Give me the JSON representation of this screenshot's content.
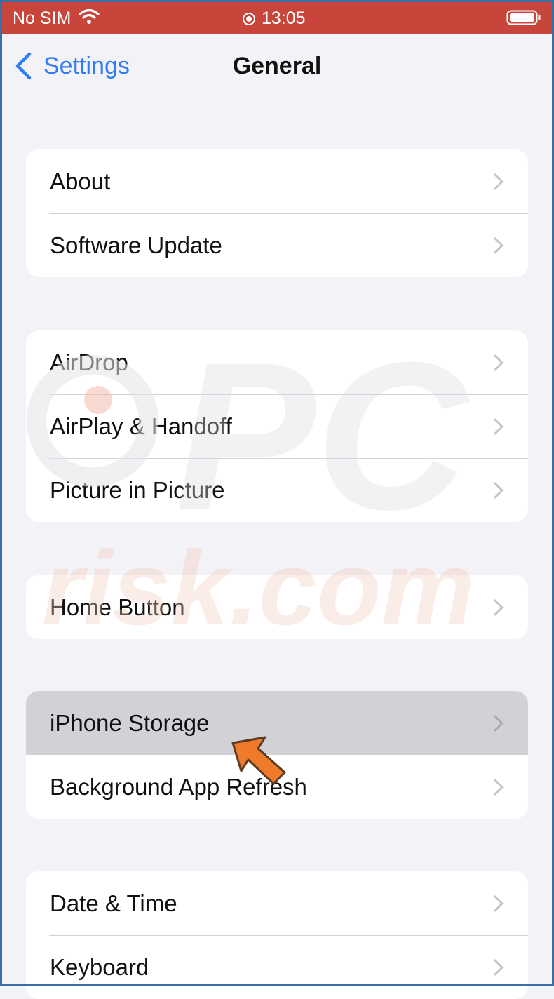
{
  "status_bar": {
    "carrier": "No SIM",
    "time": "13:05",
    "background_color": "#c8453b"
  },
  "nav": {
    "back_label": "Settings",
    "title": "General",
    "accent_color": "#2e7cf6"
  },
  "groups": [
    {
      "rows": [
        {
          "label": "About"
        },
        {
          "label": "Software Update"
        }
      ]
    },
    {
      "rows": [
        {
          "label": "AirDrop"
        },
        {
          "label": "AirPlay & Handoff"
        },
        {
          "label": "Picture in Picture"
        }
      ]
    },
    {
      "rows": [
        {
          "label": "Home Button"
        }
      ]
    },
    {
      "rows": [
        {
          "label": "iPhone Storage",
          "highlighted": true
        },
        {
          "label": "Background App Refresh"
        }
      ]
    },
    {
      "rows": [
        {
          "label": "Date & Time"
        },
        {
          "label": "Keyboard"
        }
      ]
    }
  ],
  "watermark": {
    "text": "PC risk.com"
  },
  "icons": {
    "wifi": "wifi-icon",
    "lock": "orientation-lock-icon",
    "battery": "battery-icon",
    "back": "chevron-left-icon",
    "row_chevron": "chevron-right-icon",
    "pointer": "arrow-pointer-icon"
  }
}
